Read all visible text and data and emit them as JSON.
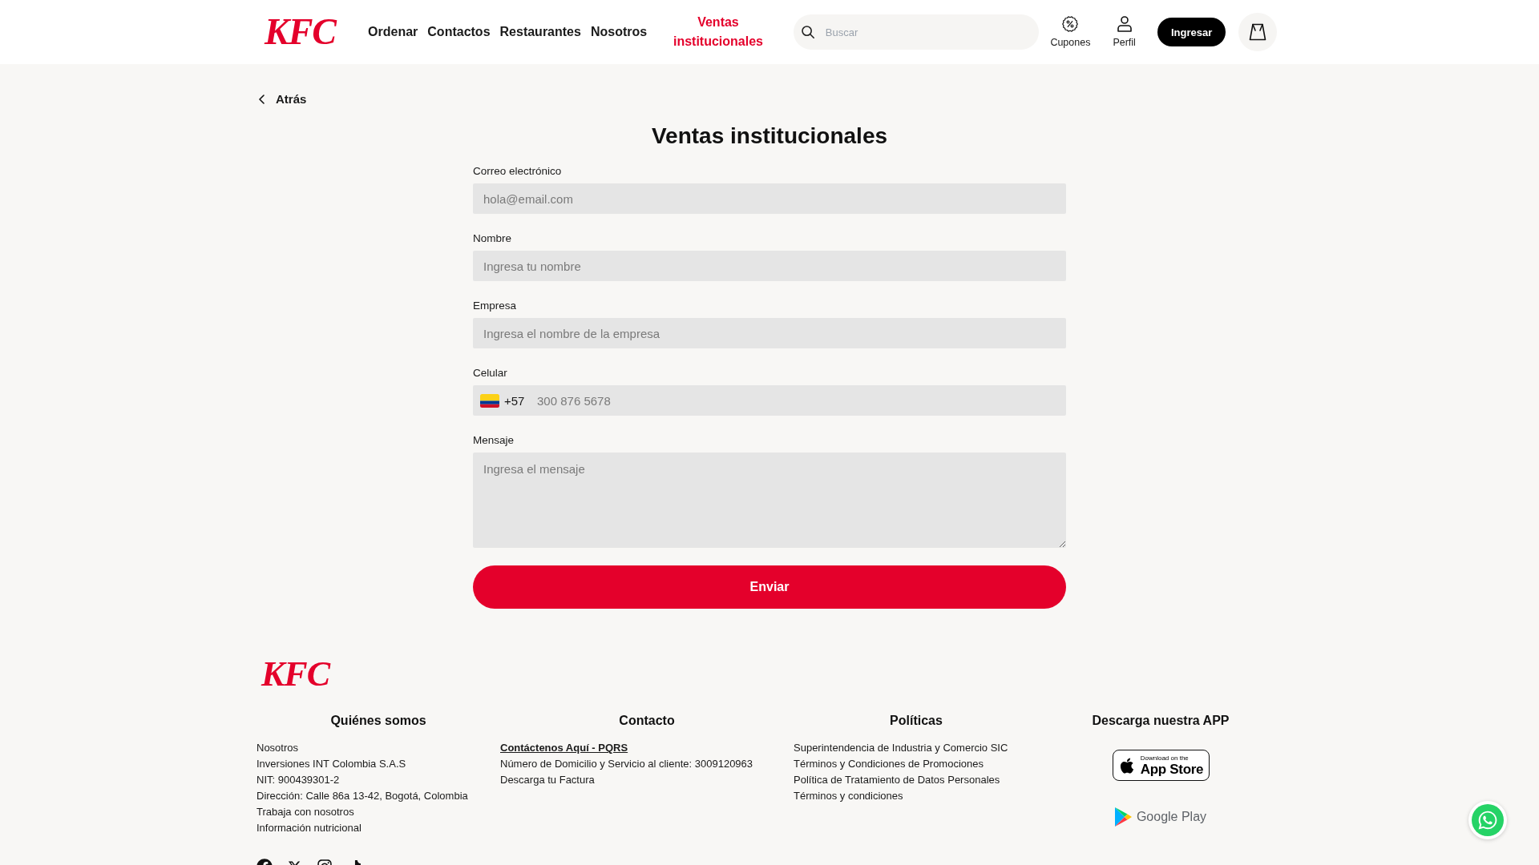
{
  "header": {
    "logo": "KFC",
    "nav": [
      {
        "label": "Ordenar",
        "selected": false
      },
      {
        "label": "Contactos",
        "selected": false
      },
      {
        "label": "Restaurantes",
        "selected": false
      },
      {
        "label": "Nosotros",
        "selected": false
      },
      {
        "label": "Ventas institucionales",
        "selected": true
      }
    ],
    "search": {
      "placeholder": "Buscar"
    },
    "actions": [
      {
        "kind": "coupons",
        "label": "Cupones"
      },
      {
        "kind": "profile",
        "label": "Perfil"
      }
    ],
    "login_button": "Ingresar"
  },
  "back_link": "Atrás",
  "title": "Ventas institucionales",
  "form": {
    "fields": [
      {
        "kind": "text",
        "label": "Correo electrónico",
        "placeholder": "hola@email.com"
      },
      {
        "kind": "text",
        "label": "Nombre",
        "placeholder": "Ingresa tu nombre"
      },
      {
        "kind": "text",
        "label": "Empresa",
        "placeholder": "Ingresa el nombre de la empresa"
      },
      {
        "kind": "phone",
        "label": "Celular",
        "country_code": "+57",
        "placeholder": "300 876 5678"
      },
      {
        "kind": "textarea",
        "label": "Mensaje",
        "placeholder": "Ingresa el mensaje"
      }
    ],
    "submit": "Enviar"
  },
  "footer": {
    "logo": "KFC",
    "columns": [
      {
        "title": "Quiénes somos",
        "links": [
          {
            "text": "Nosotros",
            "emphasized": false
          },
          {
            "text": "Inversiones INT Colombia S.A.S",
            "emphasized": false
          },
          {
            "text": "NIT: 900439301-2",
            "emphasized": false
          },
          {
            "text": "Dirección: Calle 86a 13-42, Bogotá, Colombia",
            "emphasized": false
          },
          {
            "text": "Trabaja con nosotros",
            "emphasized": false
          },
          {
            "text": "Información nutricional",
            "emphasized": false
          }
        ]
      },
      {
        "title": "Contacto",
        "links": [
          {
            "text": "Contáctenos Aquí - PQRS",
            "emphasized": true
          },
          {
            "text": "Número de Domicilio y Servicio al cliente: 3009120963",
            "emphasized": false
          },
          {
            "text": "Descarga tu Factura",
            "emphasized": false
          }
        ]
      },
      {
        "title": "Políticas",
        "links": [
          {
            "text": "Superintendencia de Industria y Comercio SIC",
            "emphasized": false
          },
          {
            "text": "Términos y Condiciones de Promociones",
            "emphasized": false
          },
          {
            "text": "Política de Tratamiento de Datos Personales",
            "emphasized": false
          },
          {
            "text": "Términos y condiciones",
            "emphasized": false
          }
        ]
      }
    ],
    "app_section": {
      "title": "Descarga nuestra APP",
      "badges": [
        {
          "kind": "app_store",
          "caption": "Download on the",
          "label": "App Store"
        },
        {
          "kind": "google_play",
          "label": "Google Play"
        }
      ]
    },
    "social": [
      {
        "kind": "facebook"
      },
      {
        "kind": "x"
      },
      {
        "kind": "instagram"
      },
      {
        "kind": "tiktok"
      }
    ]
  }
}
